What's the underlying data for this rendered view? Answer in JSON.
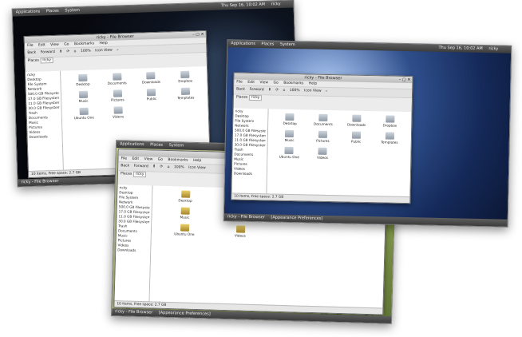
{
  "panel": {
    "applications": "Applications",
    "places": "Places",
    "system": "System",
    "clock": "Thu Sep 16, 10:02 AM",
    "user": "ricky"
  },
  "taskbar": {
    "task1": "ricky - File Browser",
    "task2": "[Appearance Preferences]"
  },
  "window": {
    "title": "ricky - File Browser",
    "menus": [
      "File",
      "Edit",
      "View",
      "Go",
      "Bookmarks",
      "Help"
    ],
    "toolbar": {
      "back": "Back",
      "forward": "Forward",
      "zoom": "100%",
      "view_mode": "Icon View"
    },
    "places_label": "Places",
    "location": "ricky",
    "sidebar": [
      "ricky",
      "Desktop",
      "File System",
      "Network",
      "500.0 GB Filesystem",
      "17.0 GB Filesystem",
      "11.0 GB Filesystem",
      "30.0 GB Filesystem",
      "Trash",
      "Documents",
      "Music",
      "Pictures",
      "Videos",
      "Downloads"
    ],
    "items": [
      "Desktop",
      "Documents",
      "Downloads",
      "Dropbox",
      "Music",
      "Pictures",
      "Public",
      "Templates",
      "Ubuntu One",
      "Videos"
    ],
    "status": "10 items, Free space: 2.7 GB"
  }
}
